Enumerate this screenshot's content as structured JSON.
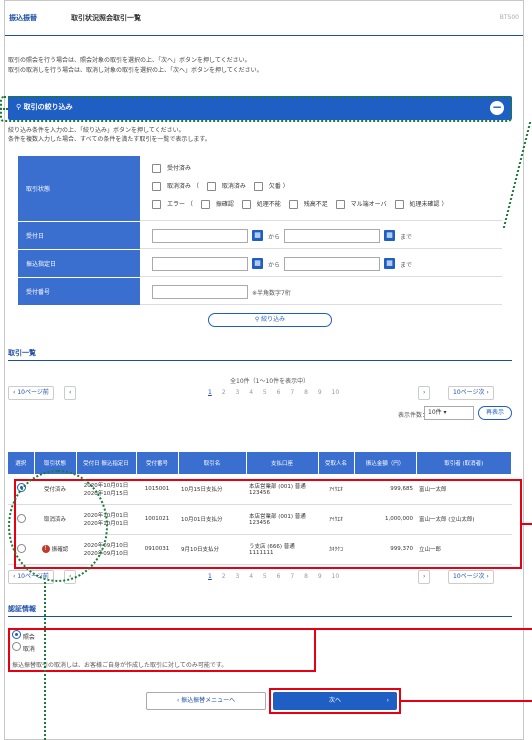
{
  "header": {
    "breadcrumb": "振込振替",
    "title": "取引状況照会取引一覧",
    "screen_code": "BTS00"
  },
  "intro": {
    "line1": "取引の照会を行う場合は、照会対象の取引を選択の上、「次へ」ボタンを押してください。",
    "line2": "取引の取消しを行う場合は、取消し対象の取引を選択の上、「次へ」ボタンを押してください。"
  },
  "filter": {
    "title": "取引の絞り込み",
    "toggle": "−",
    "note1": "絞り込み条件を入力の上、「絞り込み」ボタンを押してください。",
    "note2": "条件を複数入力した場合、すべての条件を満たす取引を一覧で表示します。",
    "status_label": "取引状態",
    "status_opt1": "受付済み",
    "status_opt2_pre": "取消済み （",
    "status_opt2a": "取消済み",
    "status_opt2b": "欠番 ）",
    "status_opt3_pre": "エラー （",
    "status_opt3a": "振確認",
    "status_opt3b": "処理不能",
    "status_opt3c": "残高不足",
    "status_opt3d": "マル端オーバ",
    "status_opt3e": "処理未確認 ）",
    "recv_date_label": "受付日",
    "transfer_date_label": "振込指定日",
    "recv_no_label": "受付番号",
    "from": "から",
    "to": "まで",
    "recv_no_hint": "※半角数字7桁",
    "submit": "絞り込み"
  },
  "list": {
    "title": "取引一覧",
    "summary": "全10件（1～10件を表示中）",
    "prev10": "10ページ前",
    "next10": "10ページ次",
    "pages": "2 3 4 5 6 7 8 9 10",
    "current_page": "1",
    "count_label": "表示件数：",
    "count_value": "10件",
    "redisplay": "再表示",
    "columns": [
      "選択",
      "取引状態",
      "受付日 振込指定日",
      "受付番号",
      "取引名",
      "支払口座",
      "受取人名",
      "振込金額（円）",
      "取引者 (取消者)"
    ],
    "rows": [
      {
        "status": "受付済み",
        "dates": "2020年10月01日 2020年10月15日",
        "no": "1015001",
        "name": "10月15日支払分",
        "account": "本店営業部 (001) 普通 123456",
        "payee": "ｱｲｳｴｵ",
        "amount": "999,685",
        "user": "富山一太郎"
      },
      {
        "status": "取消済み",
        "dates": "2020年10月01日 2020年10月01日",
        "no": "1001021",
        "name": "10月01日支払分",
        "account": "本店営業部 (001) 普通 123456",
        "payee": "ｱｲｳｴｵ",
        "amount": "1,000,000",
        "user": "富山一太郎 (立山太郎)"
      },
      {
        "status": "振確認",
        "dates": "2020年09月10日 2020年09月10日",
        "no": "0910031",
        "name": "9月10日支払分",
        "account": "う支店 (666) 普通 1111111",
        "payee": "ｶｷｸｹｺ",
        "amount": "999,370",
        "user": "立山一郎"
      }
    ]
  },
  "auth": {
    "title": "認証情報",
    "opt1": "照会",
    "opt2": "取消",
    "note": "振込振替取引の取消しは、お客様ご自身が作成した取引に対してのみ可能です。"
  },
  "footer": {
    "back": "振込振替メニューへ",
    "next": "次へ"
  },
  "colors": {
    "accent": "#1f5fc4",
    "highlight": "#e60012",
    "guide": "#1a7a3a"
  }
}
